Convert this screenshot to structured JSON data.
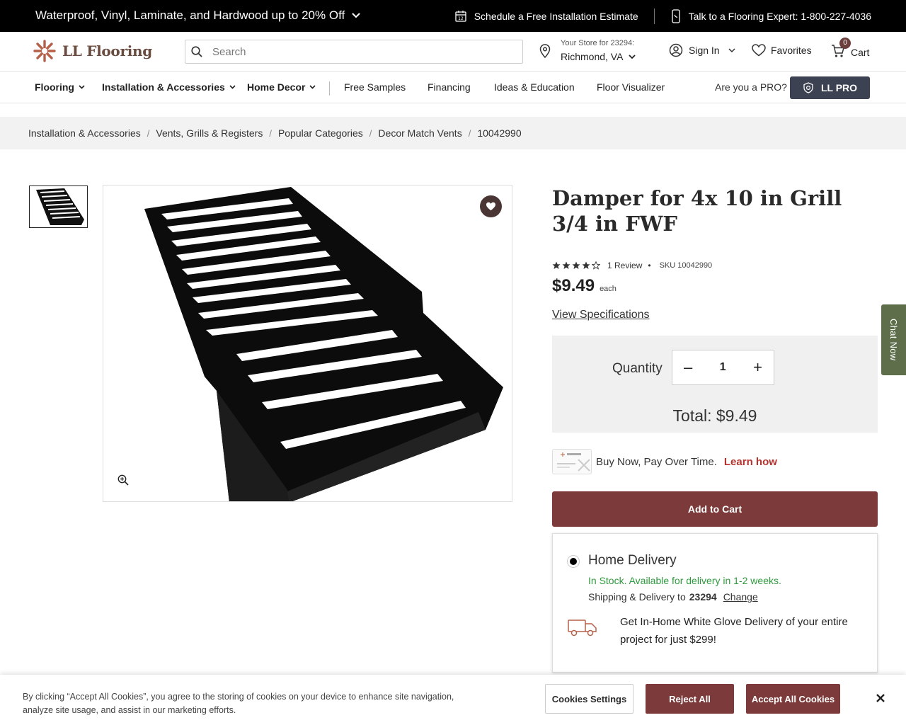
{
  "promo": {
    "left_text": "Waterproof, Vinyl, Laminate, and Hardwood up to 20% Off",
    "schedule_text": "Schedule a Free Installation Estimate",
    "expert_text": "Talk to a Flooring Expert: 1-800-227-4036"
  },
  "header": {
    "logo_text": "LL Flooring",
    "search_placeholder": "Search",
    "store_label": "Your Store for 23294:",
    "store_city": "Richmond, VA",
    "signin": "Sign In",
    "favorites": "Favorites",
    "cart": "Cart",
    "cart_count": "0"
  },
  "nav": {
    "items": [
      "Flooring",
      "Installation & Accessories",
      "Home Decor",
      "Free Samples",
      "Financing",
      "Ideas & Education",
      "Floor Visualizer"
    ],
    "pro_question": "Are you a PRO?",
    "pro_button": "LL PRO"
  },
  "breadcrumb": [
    "Installation & Accessories",
    "Vents, Grills & Registers",
    "Popular Categories",
    "Decor Match Vents",
    "10042990"
  ],
  "product": {
    "title": "Damper for 4x 10 in Grill 3/4 in FWF",
    "rating_stars": 4,
    "reviews": "1 Review",
    "sku": "SKU 10042990",
    "price": "$9.49",
    "unit": "each",
    "view_specs": "View Specifications",
    "quantity_label": "Quantity",
    "quantity": "1",
    "total": "Total: $9.49",
    "finance_text": "Buy Now, Pay Over Time.",
    "finance_link": "Learn how",
    "add_to_cart": "Add to Cart"
  },
  "delivery": {
    "title": "Home Delivery",
    "stock": "In Stock. Available for delivery in 1-2 weeks.",
    "ship_label": "Shipping & Delivery to",
    "zip": "23294",
    "change": "Change",
    "white_glove": "Get In-Home White Glove Delivery of your entire project for just $299!"
  },
  "chat": {
    "label": "Chat Now"
  },
  "cookie": {
    "text": "By clicking “Accept All Cookies”, you agree to the storing of cookies on your device to enhance site navigation, analyze site usage, and assist in our marketing efforts.",
    "settings": "Cookies Settings",
    "reject": "Reject All",
    "accept": "Accept All Cookies"
  },
  "colors": {
    "brand": "#7c3a3a",
    "pro_button": "#3c4252",
    "in_stock": "#2e9b3c",
    "chat_tab": "#5e6e4a"
  }
}
